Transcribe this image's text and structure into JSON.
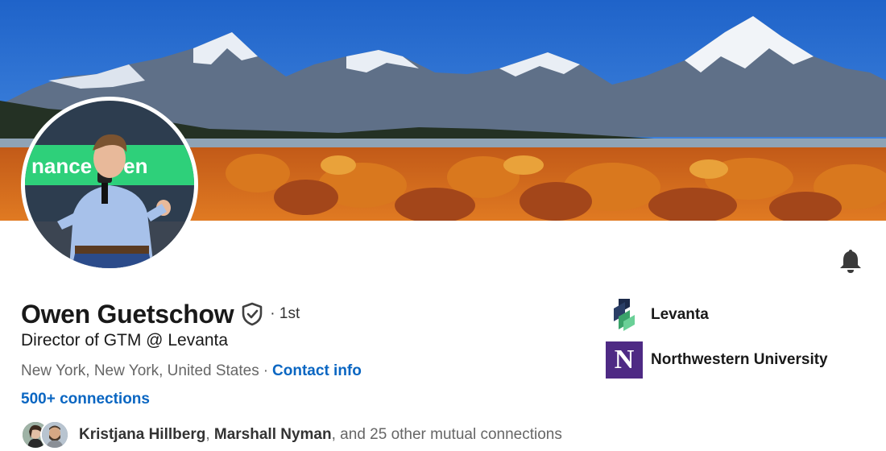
{
  "profile": {
    "name": "Owen Guetschow",
    "degree": "· 1st",
    "headline": "Director of GTM @ Levanta",
    "location": "New York, New York, United States",
    "separator": "·",
    "contact_label": "Contact info",
    "connections_label": "500+ connections"
  },
  "avatar_sign_text": "nance  riven",
  "mutual": {
    "name1": "Kristjana Hillberg",
    "comma": ",",
    "name2": "Marshall Nyman",
    "rest": ", and 25 other mutual connections"
  },
  "organizations": [
    {
      "name": "Levanta",
      "logo": "levanta-logo"
    },
    {
      "name": "Northwestern University",
      "logo": "northwestern-logo",
      "logo_letter": "N"
    }
  ],
  "icons": {
    "verified": "shield-check-icon",
    "notifications": "bell-icon"
  },
  "colors": {
    "link": "#0a66c2",
    "northwestern_purple": "#4e2a84"
  }
}
